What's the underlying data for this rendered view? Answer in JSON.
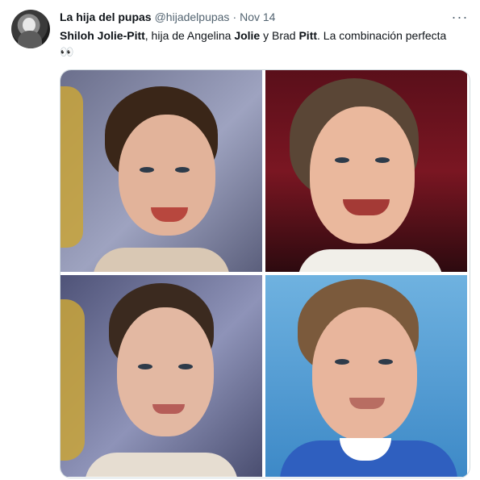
{
  "tweet": {
    "author_name": "La hija del pupas",
    "handle": "@hijadelpupas",
    "separator": "·",
    "date": "Nov 14",
    "more_icon": "···",
    "text_parts": [
      {
        "t": "Shiloh Jolie-Pitt",
        "bold": true
      },
      {
        "t": ", hija de Angelina ",
        "bold": false
      },
      {
        "t": "Jolie",
        "bold": true
      },
      {
        "t": " y Brad ",
        "bold": false
      },
      {
        "t": "Pitt",
        "bold": true
      },
      {
        "t": ". La combinación perfecta 👀",
        "bold": false
      }
    ]
  },
  "colors": {
    "text_primary": "#0f1419",
    "text_secondary": "#536471",
    "border": "#cfd9de"
  },
  "media": {
    "image_count": 4
  }
}
